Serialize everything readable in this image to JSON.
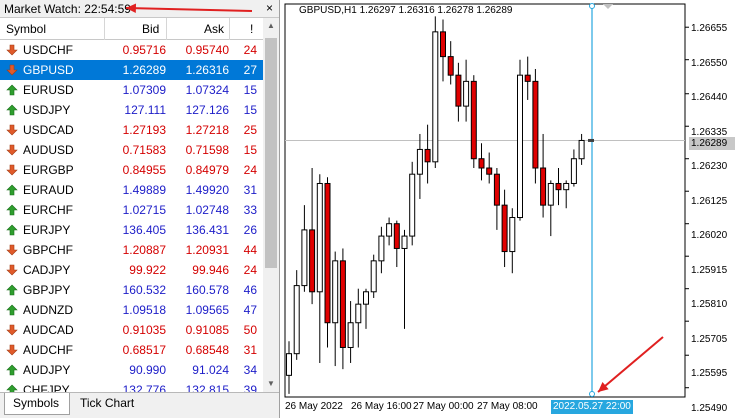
{
  "market_watch": {
    "title": "Market Watch: 22:54:59",
    "close_label": "×",
    "columns": {
      "symbol": "Symbol",
      "bid": "Bid",
      "ask": "Ask",
      "spread": "!"
    },
    "rows": [
      {
        "symbol": "USDCHF",
        "bid": "0.95716",
        "ask": "0.95740",
        "spread": "24",
        "dir": "down",
        "color": "red"
      },
      {
        "symbol": "GBPUSD",
        "bid": "1.26289",
        "ask": "1.26316",
        "spread": "27",
        "dir": "down",
        "color": "selected"
      },
      {
        "symbol": "EURUSD",
        "bid": "1.07309",
        "ask": "1.07324",
        "spread": "15",
        "dir": "up",
        "color": "blue"
      },
      {
        "symbol": "USDJPY",
        "bid": "127.111",
        "ask": "127.126",
        "spread": "15",
        "dir": "up",
        "color": "blue"
      },
      {
        "symbol": "USDCAD",
        "bid": "1.27193",
        "ask": "1.27218",
        "spread": "25",
        "dir": "down",
        "color": "red"
      },
      {
        "symbol": "AUDUSD",
        "bid": "0.71583",
        "ask": "0.71598",
        "spread": "15",
        "dir": "down",
        "color": "red"
      },
      {
        "symbol": "EURGBP",
        "bid": "0.84955",
        "ask": "0.84979",
        "spread": "24",
        "dir": "down",
        "color": "red"
      },
      {
        "symbol": "EURAUD",
        "bid": "1.49889",
        "ask": "1.49920",
        "spread": "31",
        "dir": "up",
        "color": "blue"
      },
      {
        "symbol": "EURCHF",
        "bid": "1.02715",
        "ask": "1.02748",
        "spread": "33",
        "dir": "up",
        "color": "blue"
      },
      {
        "symbol": "EURJPY",
        "bid": "136.405",
        "ask": "136.431",
        "spread": "26",
        "dir": "up",
        "color": "blue"
      },
      {
        "symbol": "GBPCHF",
        "bid": "1.20887",
        "ask": "1.20931",
        "spread": "44",
        "dir": "down",
        "color": "red"
      },
      {
        "symbol": "CADJPY",
        "bid": "99.922",
        "ask": "99.946",
        "spread": "24",
        "dir": "down",
        "color": "red"
      },
      {
        "symbol": "GBPJPY",
        "bid": "160.532",
        "ask": "160.578",
        "spread": "46",
        "dir": "up",
        "color": "blue"
      },
      {
        "symbol": "AUDNZD",
        "bid": "1.09518",
        "ask": "1.09565",
        "spread": "47",
        "dir": "up",
        "color": "blue"
      },
      {
        "symbol": "AUDCAD",
        "bid": "0.91035",
        "ask": "0.91085",
        "spread": "50",
        "dir": "down",
        "color": "red"
      },
      {
        "symbol": "AUDCHF",
        "bid": "0.68517",
        "ask": "0.68548",
        "spread": "31",
        "dir": "down",
        "color": "red"
      },
      {
        "symbol": "AUDJPY",
        "bid": "90.990",
        "ask": "91.024",
        "spread": "34",
        "dir": "up",
        "color": "blue"
      },
      {
        "symbol": "CHFJPY",
        "bid": "132.776",
        "ask": "132.815",
        "spread": "39",
        "dir": "up",
        "color": "blue"
      }
    ],
    "tabs": [
      "Symbols",
      "Tick Chart"
    ],
    "colors": {
      "up": "#1c1cc8",
      "down": "#d40000",
      "selected": "#0078d7",
      "up_icon": "#2e9e2e",
      "down_icon": "#e05a2a"
    }
  },
  "chart": {
    "symbol_label": "GBPUSD,H1  1.26297 1.26316 1.26278 1.26289",
    "current_price_tag": "1.26289",
    "crosshair_date": "2022.05.27 22:00",
    "price_labels": [
      "1.26655",
      "1.26550",
      "1.26440",
      "1.26335",
      "1.26230",
      "1.26125",
      "1.26020",
      "1.25915",
      "1.25810",
      "1.25705",
      "1.25595",
      "1.25490"
    ],
    "time_labels": [
      "26 May 2022",
      "26 May 16:00",
      "27 May 00:00",
      "27 May 08:00"
    ],
    "colors": {
      "bull_body": "#ffffff",
      "bear_body": "#e00000",
      "wick": "#000000",
      "crosshair": "#27a7df",
      "annotation_arrow": "#e02020"
    }
  },
  "chart_data": {
    "type": "candlestick",
    "title": "GBPUSD,H1",
    "ylim": [
      1.2546,
      1.2673
    ],
    "candles": [
      {
        "o": 1.2553,
        "h": 1.2564,
        "l": 1.2547,
        "c": 1.256
      },
      {
        "o": 1.256,
        "h": 1.2587,
        "l": 1.2558,
        "c": 1.2582
      },
      {
        "o": 1.2582,
        "h": 1.2608,
        "l": 1.258,
        "c": 1.26
      },
      {
        "o": 1.26,
        "h": 1.262,
        "l": 1.2576,
        "c": 1.258
      },
      {
        "o": 1.258,
        "h": 1.2618,
        "l": 1.2557,
        "c": 1.2615
      },
      {
        "o": 1.2615,
        "h": 1.2617,
        "l": 1.2562,
        "c": 1.257
      },
      {
        "o": 1.257,
        "h": 1.2593,
        "l": 1.2556,
        "c": 1.259
      },
      {
        "o": 1.259,
        "h": 1.2594,
        "l": 1.2555,
        "c": 1.2562
      },
      {
        "o": 1.2562,
        "h": 1.2577,
        "l": 1.2557,
        "c": 1.257
      },
      {
        "o": 1.257,
        "h": 1.2581,
        "l": 1.2562,
        "c": 1.2576
      },
      {
        "o": 1.2576,
        "h": 1.2581,
        "l": 1.2568,
        "c": 1.258
      },
      {
        "o": 1.258,
        "h": 1.2592,
        "l": 1.2578,
        "c": 1.259
      },
      {
        "o": 1.259,
        "h": 1.2601,
        "l": 1.2586,
        "c": 1.2598
      },
      {
        "o": 1.2598,
        "h": 1.2604,
        "l": 1.2595,
        "c": 1.2602
      },
      {
        "o": 1.2602,
        "h": 1.2603,
        "l": 1.2588,
        "c": 1.2594
      },
      {
        "o": 1.2594,
        "h": 1.26,
        "l": 1.2568,
        "c": 1.2598
      },
      {
        "o": 1.2598,
        "h": 1.2622,
        "l": 1.2595,
        "c": 1.2618
      },
      {
        "o": 1.2618,
        "h": 1.2631,
        "l": 1.261,
        "c": 1.2626
      },
      {
        "o": 1.2626,
        "h": 1.2634,
        "l": 1.2615,
        "c": 1.2622
      },
      {
        "o": 1.2622,
        "h": 1.2669,
        "l": 1.262,
        "c": 1.2664
      },
      {
        "o": 1.2664,
        "h": 1.2668,
        "l": 1.2648,
        "c": 1.2656
      },
      {
        "o": 1.2656,
        "h": 1.2661,
        "l": 1.2647,
        "c": 1.265
      },
      {
        "o": 1.265,
        "h": 1.2654,
        "l": 1.2635,
        "c": 1.264
      },
      {
        "o": 1.264,
        "h": 1.2655,
        "l": 1.2635,
        "c": 1.2648
      },
      {
        "o": 1.2648,
        "h": 1.265,
        "l": 1.262,
        "c": 1.2623
      },
      {
        "o": 1.2623,
        "h": 1.2628,
        "l": 1.2616,
        "c": 1.262
      },
      {
        "o": 1.262,
        "h": 1.2625,
        "l": 1.2615,
        "c": 1.2618
      },
      {
        "o": 1.2618,
        "h": 1.262,
        "l": 1.26,
        "c": 1.2608
      },
      {
        "o": 1.2608,
        "h": 1.2613,
        "l": 1.2588,
        "c": 1.2593
      },
      {
        "o": 1.2593,
        "h": 1.2607,
        "l": 1.2586,
        "c": 1.2604
      },
      {
        "o": 1.2604,
        "h": 1.2655,
        "l": 1.2603,
        "c": 1.265
      },
      {
        "o": 1.265,
        "h": 1.2656,
        "l": 1.2642,
        "c": 1.2648
      },
      {
        "o": 1.2648,
        "h": 1.2652,
        "l": 1.2615,
        "c": 1.262
      },
      {
        "o": 1.262,
        "h": 1.2631,
        "l": 1.2604,
        "c": 1.2608
      },
      {
        "o": 1.2608,
        "h": 1.2616,
        "l": 1.2598,
        "c": 1.2615
      },
      {
        "o": 1.2615,
        "h": 1.262,
        "l": 1.2608,
        "c": 1.2613
      },
      {
        "o": 1.2613,
        "h": 1.2616,
        "l": 1.2607,
        "c": 1.2615
      },
      {
        "o": 1.2615,
        "h": 1.2626,
        "l": 1.2614,
        "c": 1.2623
      },
      {
        "o": 1.2623,
        "h": 1.2631,
        "l": 1.2621,
        "c": 1.26289
      }
    ]
  }
}
